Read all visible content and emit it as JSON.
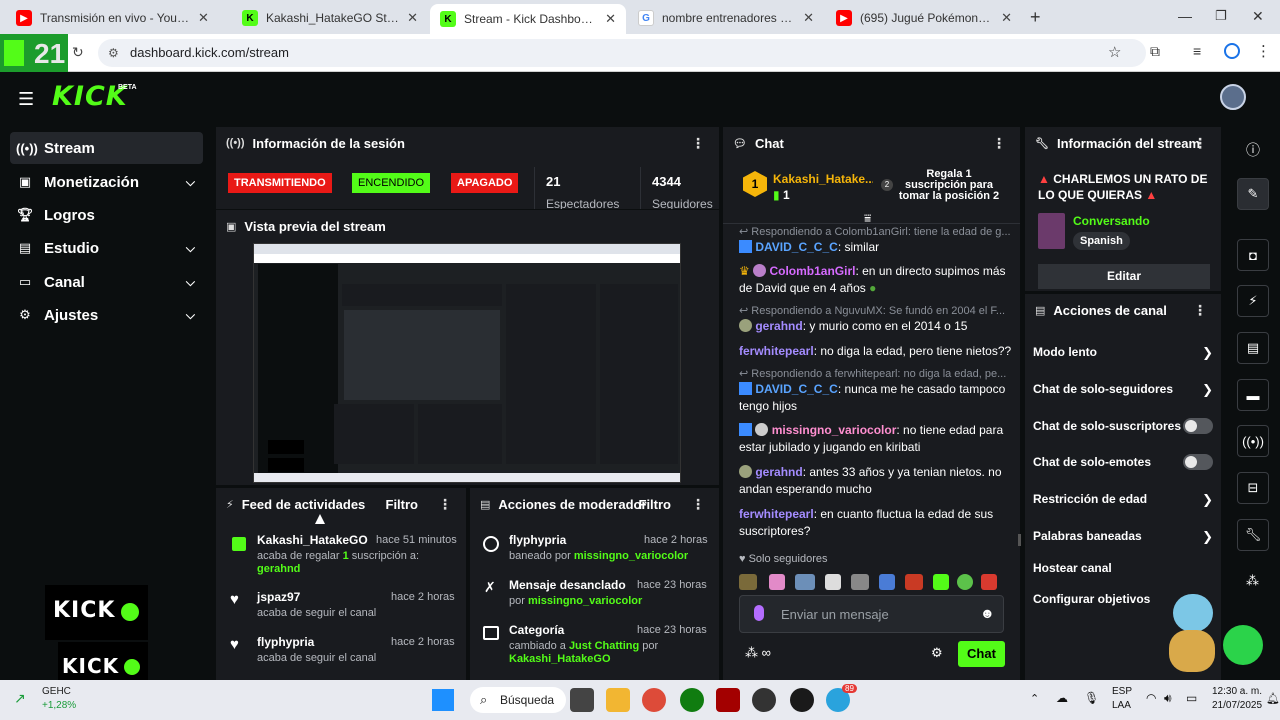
{
  "browser": {
    "tabs": [
      {
        "title": "Transmisión en vivo - YouTube St",
        "favicon": "youtube-icon",
        "color": "#ff0000"
      },
      {
        "title": "Kakashi_HatakeGO Stream - Watc",
        "favicon": "kick-icon",
        "color": "#53fc18"
      },
      {
        "title": "Stream - Kick Dashboard",
        "favicon": "kick-icon",
        "color": "#53fc18"
      },
      {
        "title": "nombre entrenadores de eevee",
        "favicon": "google-icon",
        "color": "#4285f4"
      },
      {
        "title": "(695) Jugué Pokémon GO en el m",
        "favicon": "youtube-icon",
        "color": "#ff0000"
      }
    ],
    "url": "dashboard.kick.com/stream",
    "overlay_counter": "21"
  },
  "brand": {
    "logo": "KICK",
    "beta": "BETA",
    "accent": "#53fc18"
  },
  "sidebar": {
    "items": [
      {
        "label": "Stream",
        "icon": "broadcast-icon"
      },
      {
        "label": "Monetización",
        "icon": "money-icon"
      },
      {
        "label": "Logros",
        "icon": "trophy-icon"
      },
      {
        "label": "Estudio",
        "icon": "studio-icon"
      },
      {
        "label": "Canal",
        "icon": "channel-icon"
      },
      {
        "label": "Ajustes",
        "icon": "gear-icon"
      }
    ]
  },
  "session": {
    "title": "Información de la sesión",
    "badge_live": "TRANSMITIENDO",
    "badge_on": "ENCENDIDO",
    "badge_off": "APAGADO",
    "viewers": "21",
    "viewers_label": "Espectadores",
    "followers": "4344",
    "followers_label": "Seguidores"
  },
  "preview": {
    "title": "Vista previa del stream",
    "overlay_logo": "KICK"
  },
  "feed": {
    "title": "Feed de actividades",
    "filter": "Filtro",
    "items": [
      {
        "user": "Kakashi_HatakeGO",
        "time": "hace 51 minutos",
        "line1_pre": "acaba de regalar ",
        "count": "1",
        "line1_post": " suscripción a:",
        "target": "gerahnd",
        "icon": "gift-icon"
      },
      {
        "user": "jspaz97",
        "time": "hace 2 horas",
        "text": "acaba de seguir el canal",
        "icon": "heart-icon"
      },
      {
        "user": "flyphypria",
        "time": "hace 2 horas",
        "text": "acaba de seguir el canal",
        "icon": "heart-icon"
      }
    ]
  },
  "modactions": {
    "title": "Acciones de moderador",
    "filter": "Filtro",
    "items": [
      {
        "title": "flyphypria",
        "time": "hace 2 horas",
        "pre": "baneado por ",
        "user": "missingno_variocolor",
        "icon": "ban-icon"
      },
      {
        "title": "Mensaje desanclado",
        "time": "hace 23 horas",
        "pre": "por ",
        "user": "missingno_variocolor",
        "icon": "unpin-icon"
      },
      {
        "title": "Categoría",
        "time": "hace 23 horas",
        "pre": "cambiado a ",
        "cat": "Just Chatting",
        "mid": " por",
        "user": "Kakashi_HatakeGO",
        "icon": "category-icon"
      }
    ]
  },
  "chat": {
    "title": "Chat",
    "pinned_user": "Kakashi_Hatake...",
    "pinned_rank": "1",
    "pinned_count": "1",
    "gift_rank": "2",
    "gift_text": "Regala 1 suscripción para tomar la posición 2",
    "messages": [
      {
        "reply": "Respondiendo a Colomb1anGirl: tiene la edad de g...",
        "user": "DAVID_C_C_C",
        "ucolor": "#5aa4ff",
        "text": ": similar"
      },
      {
        "user": "Colomb1anGirl",
        "ucolor": "#d66bff",
        "text": ": en un directo supimos más de David que en 4 años"
      },
      {
        "reply": "Respondiendo a NguvuMX: Se fundó en 2004 el F...",
        "user": "gerahnd",
        "ucolor": "#a48cff",
        "text": ": y murio como en el 2014 o 15"
      },
      {
        "user": "ferwhitepearl",
        "ucolor": "#a48cff",
        "text": ": no diga la edad, pero tiene nietos??"
      },
      {
        "reply": "Respondiendo a ferwhitepearl: no diga la edad, pe...",
        "user": "DAVID_C_C_C",
        "ucolor": "#5aa4ff",
        "text": ": nunca me he casado tampoco tengo hijos"
      },
      {
        "user": "missingno_variocolor",
        "ucolor": "#ff8fd0",
        "text": ": no tiene edad para estar jubilado y jugando en kiribati"
      },
      {
        "user": "gerahnd",
        "ucolor": "#a48cff",
        "text": ": antes 33 años y ya tenian nietos. no andan esperando mucho"
      },
      {
        "user": "ferwhitepearl",
        "ucolor": "#a48cff",
        "text": ": en cuanto fluctua la edad de sus suscriptores?"
      }
    ],
    "mode_label": "Solo seguidores",
    "input_placeholder": "Enviar un mensaje",
    "send_label": "Chat"
  },
  "streaminfo": {
    "title": "Información del stream",
    "stream_title": "CHARLEMOS UN RATO DE LO QUE QUIERAS",
    "category": "Conversando",
    "language": "Spanish",
    "edit_label": "Editar"
  },
  "channel_actions": {
    "title": "Acciones de canal",
    "items": [
      {
        "label": "Modo lento",
        "control": "chevron"
      },
      {
        "label": "Chat de solo-seguidores",
        "control": "chevron"
      },
      {
        "label": "Chat de solo-suscriptores",
        "control": "toggle"
      },
      {
        "label": "Chat de solo-emotes",
        "control": "toggle"
      },
      {
        "label": "Restricción de edad",
        "control": "chevron"
      },
      {
        "label": "Palabras baneadas",
        "control": "chevron"
      },
      {
        "label": "Hostear canal",
        "control": "none"
      },
      {
        "label": "Configurar objetivos",
        "control": "none"
      }
    ]
  },
  "taskbar": {
    "stock_name": "GEHC",
    "stock_change": "+1,28%",
    "search_label": "Búsqueda",
    "lang": "ESP",
    "lang2": "LAA",
    "time": "12:30 a. m.",
    "date": "21/07/2025",
    "notif_badge": "89"
  }
}
